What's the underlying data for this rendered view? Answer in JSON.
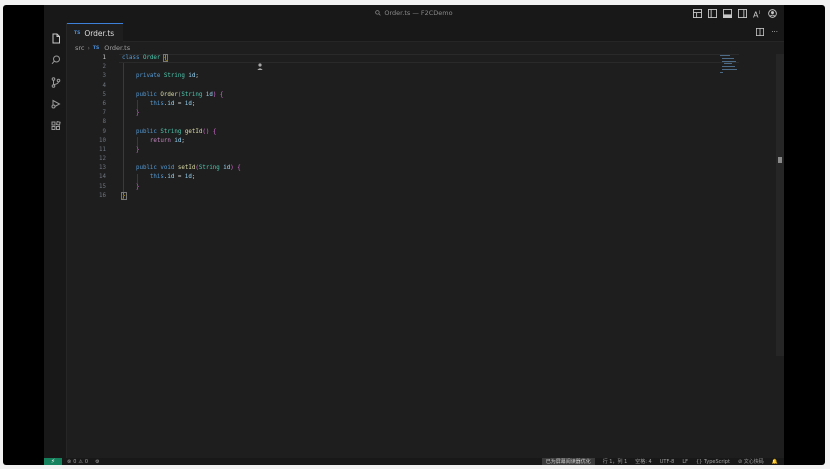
{
  "window": {
    "title": "Order.ts — F2CDemo"
  },
  "activity_bar": {
    "items": [
      {
        "name": "explorer",
        "icon": "files-icon"
      },
      {
        "name": "search",
        "icon": "search-icon"
      },
      {
        "name": "source-control",
        "icon": "source-control-icon"
      },
      {
        "name": "run-debug",
        "icon": "run-debug-icon"
      },
      {
        "name": "extensions",
        "icon": "extensions-icon"
      }
    ]
  },
  "tabs": [
    {
      "badge": "TS",
      "label": "Order.ts",
      "active": true
    }
  ],
  "breadcrumb": {
    "folder": "src",
    "file_badge": "TS",
    "file": "Order.ts"
  },
  "editor": {
    "active_line": 1,
    "line_numbers": [
      "1",
      "2",
      "3",
      "4",
      "5",
      "6",
      "7",
      "8",
      "9",
      "10",
      "11",
      "12",
      "13",
      "14",
      "15",
      "16"
    ]
  },
  "status_bar": {
    "errors": "0",
    "warnings": "0",
    "screen_reader": "已为屏幕阅读器优化",
    "position": "行 1，列 1",
    "indent": "空格: 4",
    "encoding": "UTF-8",
    "eol": "LF",
    "language": "TypeScript",
    "assistant": "文心快码"
  },
  "colors": {
    "accent": "#3c80d9",
    "remote": "#16825d",
    "keyword": "#569cd6",
    "type": "#4ec9b0",
    "function": "#dcdcaa",
    "variable": "#9cdcfe"
  }
}
